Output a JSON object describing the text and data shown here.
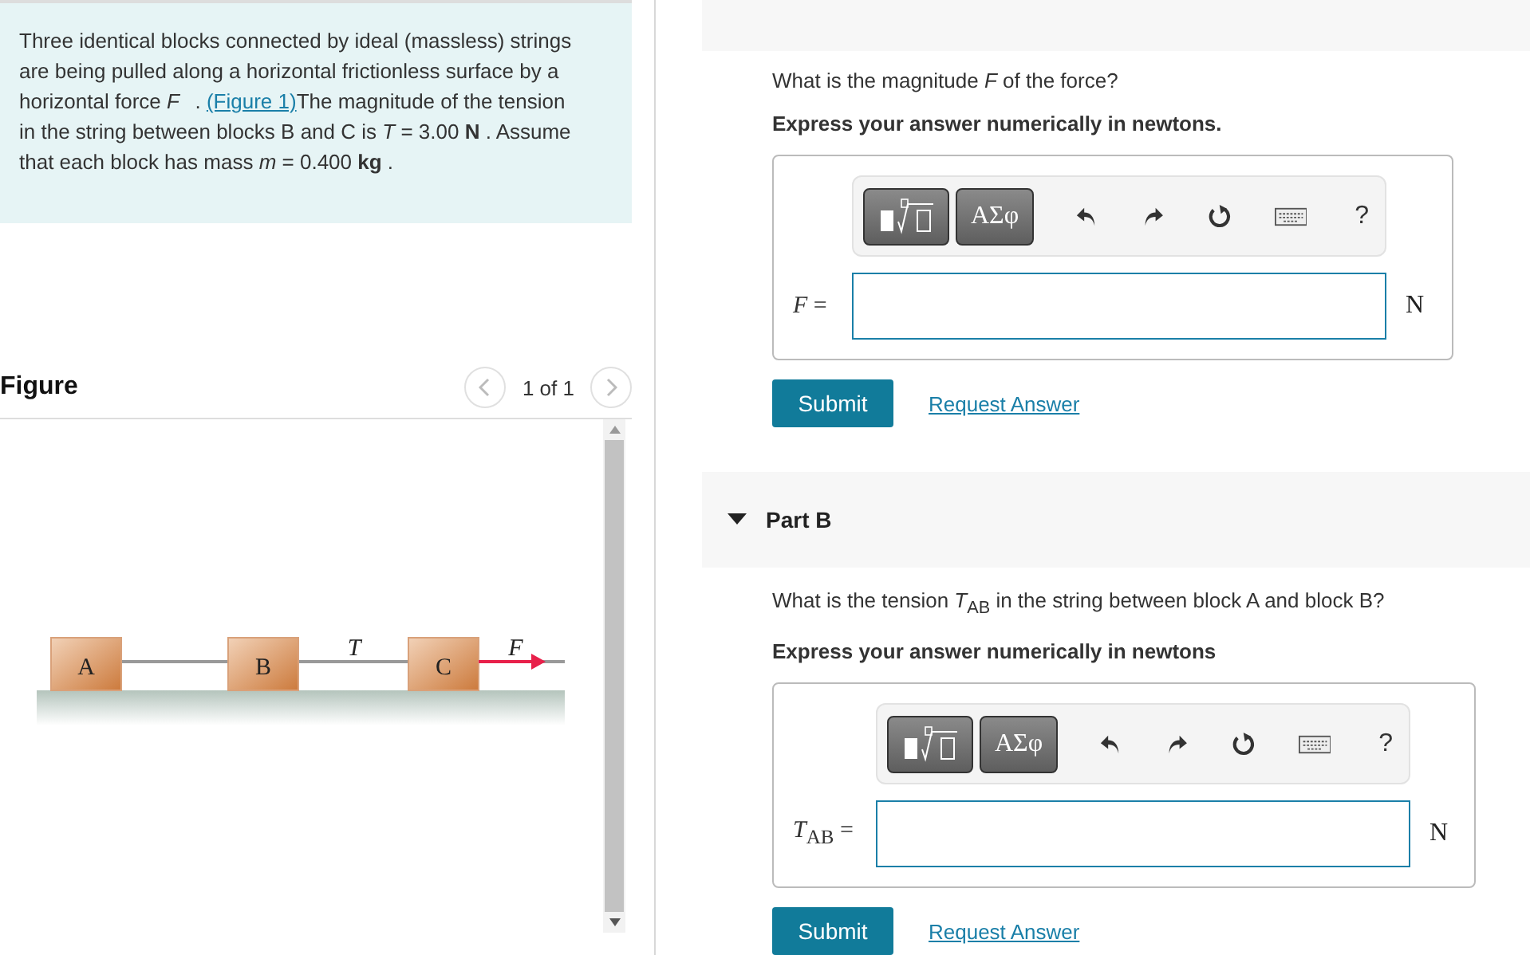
{
  "problem": {
    "text_before": "Three identical blocks connected by ideal (massless) strings are being pulled along a horizontal frictionless surface by a horizontal force *F⃗*.",
    "link": "(Figure 1)",
    "text_after": "The magnitude of the tension in the string between blocks B and C is *T* = 3.00 **N** . Assume that each block has mass *m* = 0.400 **kg** ."
  },
  "figure": {
    "title": "Figure",
    "pager": "1 of 1",
    "blocks": [
      "A",
      "B",
      "C"
    ],
    "tension_label": "T",
    "force_label": "F⃗"
  },
  "parts": [
    {
      "question": "What is the magnitude *F* of the force?",
      "instruction": "Express your answer numerically in newtons.",
      "greek_label": "ΑΣφ",
      "help_label": "?",
      "variable": "*F* =",
      "unit": "N",
      "submit": "Submit",
      "request": "Request Answer"
    },
    {
      "title": "Part B",
      "expanded": true,
      "question": "What is the tension *T*$_{AB}$ in the string between block A and block B?",
      "instruction": "Express your answer numerically in newtons",
      "greek_label": "ΑΣφ",
      "help_label": "?",
      "variable": "*T*$_{AB}$ =",
      "unit": "N",
      "submit": "Submit",
      "request": "Request Answer"
    }
  ]
}
